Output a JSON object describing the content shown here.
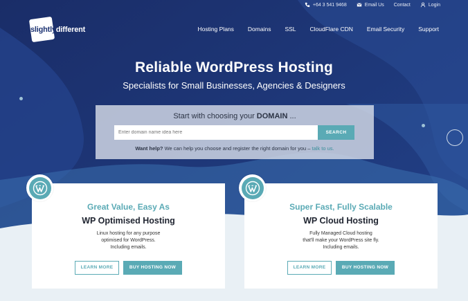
{
  "topbar": {
    "phone": "+64 3 541 9468",
    "email": "Email Us",
    "contact": "Contact",
    "login": "Login"
  },
  "logo": {
    "part1": "slightly",
    "part2": "different"
  },
  "nav": {
    "items": [
      "Hosting Plans",
      "Domains",
      "SSL",
      "CloudFlare CDN",
      "Email Security",
      "Support"
    ]
  },
  "hero": {
    "title": "Reliable WordPress Hosting",
    "subtitle": "Specialists for Small Businesses, Agencies & Designers"
  },
  "search": {
    "heading_prefix": "Start with choosing your",
    "heading_bold": "DOMAIN",
    "heading_suffix": " ...",
    "placeholder": "Enter domain name idea here",
    "button": "SEARCH",
    "help_bold": "Want help?",
    "help_text": " We can help you choose and register the right domain for you – ",
    "help_link": "talk to us."
  },
  "cards": [
    {
      "kicker": "Great Value, Easy As",
      "title": "WP Optimised Hosting",
      "desc": [
        "Linux hosting for any purpose",
        "optimised for WordPress.",
        "Including emails."
      ],
      "learn_more": "LEARN MORE",
      "buy": "BUY HOSTING NOW"
    },
    {
      "kicker": "Super Fast, Fully Scalable",
      "title": "WP Cloud Hosting",
      "desc": [
        "Fully Managed Cloud hosting",
        "that'll make your WordPress site fly.",
        "Including emails."
      ],
      "learn_more": "LEARN MORE",
      "buy": "BUY HOSTING NOW"
    }
  ],
  "colors": {
    "navy": "#1d3372",
    "teal": "#5aaab5",
    "light": "#e9f0f5"
  },
  "icons": [
    "phone-icon",
    "email-icon",
    "user-icon",
    "wordpress-icon"
  ]
}
